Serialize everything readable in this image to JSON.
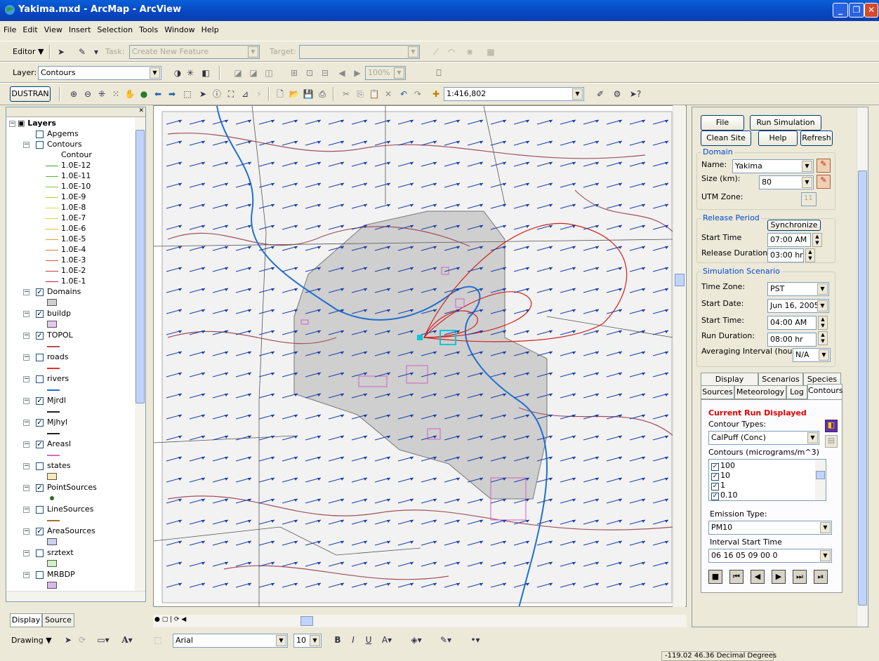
{
  "window": {
    "title": "Yakima.mxd - ArcMap - ArcView"
  },
  "menu": [
    "File",
    "Edit",
    "View",
    "Insert",
    "Selection",
    "Tools",
    "Window",
    "Help"
  ],
  "editor": {
    "label": "Editor ▼",
    "task_label": "Task:",
    "task_value": "Create New Feature",
    "target_label": "Target:"
  },
  "layerbar": {
    "label": "Layer:",
    "value": "Contours",
    "zoom": "100%"
  },
  "dustran": {
    "label": "DUSTRAN",
    "scale": "1:416,802"
  },
  "toc": {
    "root": "Layers",
    "layers": [
      {
        "name": "Apgems",
        "checked": false
      },
      {
        "name": "Contours",
        "checked": false,
        "legend_title": "Contour",
        "legend": [
          {
            "label": "1.0E-12",
            "color": "#3aa03a"
          },
          {
            "label": "1.0E-11",
            "color": "#5cb43c"
          },
          {
            "label": "1.0E-10",
            "color": "#86c43c"
          },
          {
            "label": "1.0E-9",
            "color": "#b2d23c"
          },
          {
            "label": "1.0E-8",
            "color": "#d6dc3c"
          },
          {
            "label": "1.0E-7",
            "color": "#e6d23c"
          },
          {
            "label": "1.0E-6",
            "color": "#e6b63c"
          },
          {
            "label": "1.0E-5",
            "color": "#e69a3c"
          },
          {
            "label": "1.0E-4",
            "color": "#e07a3a"
          },
          {
            "label": "1.0E-3",
            "color": "#d85a38"
          },
          {
            "label": "1.0E-2",
            "color": "#d03a36"
          },
          {
            "label": "1.0E-1",
            "color": "#c81e32"
          }
        ]
      },
      {
        "name": "Domains",
        "checked": true,
        "swatch": "#cfcfcf",
        "stype": "box"
      },
      {
        "name": "buildp",
        "checked": true,
        "swatch": "#e8c8f0",
        "stype": "box"
      },
      {
        "name": "TOPOL",
        "checked": true,
        "swatch": "#b05060",
        "stype": "line"
      },
      {
        "name": "roads",
        "checked": false,
        "swatch": "#e03030",
        "stype": "line"
      },
      {
        "name": "rivers",
        "checked": false,
        "swatch": "#1f6fd0",
        "stype": "line"
      },
      {
        "name": "Mjrdl",
        "checked": true,
        "swatch": "#222222",
        "stype": "line"
      },
      {
        "name": "Mjhyl",
        "checked": true,
        "swatch": "#222222",
        "stype": "line"
      },
      {
        "name": "Areasl",
        "checked": true,
        "swatch": "#d070c0",
        "stype": "line"
      },
      {
        "name": "states",
        "checked": false,
        "swatch": "#fce8b8",
        "stype": "box"
      },
      {
        "name": "PointSources",
        "checked": true,
        "swatch": "#2a6a2a",
        "stype": "dot"
      },
      {
        "name": "LineSources",
        "checked": false,
        "swatch": "#a07030",
        "stype": "line"
      },
      {
        "name": "AreaSources",
        "checked": true,
        "swatch": "#c8d4f0",
        "stype": "box"
      },
      {
        "name": "srztext",
        "checked": false,
        "swatch": "#d0f0c8",
        "stype": "box"
      },
      {
        "name": "MRBDP",
        "checked": false,
        "swatch": "#d8b8e8",
        "stype": "box"
      }
    ],
    "tabs": [
      "Display",
      "Source"
    ]
  },
  "panel": {
    "buttons": {
      "file": "File",
      "run": "Run Simulation",
      "clean": "Clean Site",
      "help": "Help",
      "refresh": "Refresh"
    },
    "domain": {
      "title": "Domain",
      "name_label": "Name:",
      "name_value": "Yakima",
      "size_label": "Size (km):",
      "size_value": "80",
      "utm_label": "UTM Zone:",
      "utm_value": "11"
    },
    "release": {
      "title": "Release Period",
      "sync": "Synchronize",
      "start_label": "Start Time",
      "start_value": "07:00 AM",
      "dur_label": "Release Duration:",
      "dur_value": "03:00 hr"
    },
    "scenario": {
      "title": "Simulation Scenario",
      "tz_label": "Time Zone:",
      "tz_value": "PST",
      "date_label": "Start Date:",
      "date_value": "Jun 16, 2005",
      "time_label": "Start Time:",
      "time_value": "04:00 AM",
      "run_label": "Run Duration:",
      "run_value": "08:00 hr",
      "avg_label": "Averaging Interval (hour):",
      "avg_value": "N/A"
    },
    "tabs_row1": [
      "Display Options",
      "Scenarios",
      "Species"
    ],
    "tabs_row2": [
      "Sources",
      "Meteorology",
      "Log",
      "Contours"
    ],
    "contours": {
      "current": "Current Run Displayed",
      "types_label": "Contour Types:",
      "type_value": "CalPuff (Conc)",
      "list_label": "Contours (micrograms/m^3)",
      "list": [
        "100",
        "10",
        "1",
        "0.10"
      ],
      "emission_label": "Emission Type:",
      "emission_value": "PM10",
      "interval_label": "Interval Start Time",
      "interval_value": "06 16 05 09 00 0"
    }
  },
  "drawing": {
    "label": "Drawing ▼",
    "font": "Arial",
    "size": "10"
  },
  "status": {
    "coords": "-119.02  46.36 Decimal Degrees"
  }
}
